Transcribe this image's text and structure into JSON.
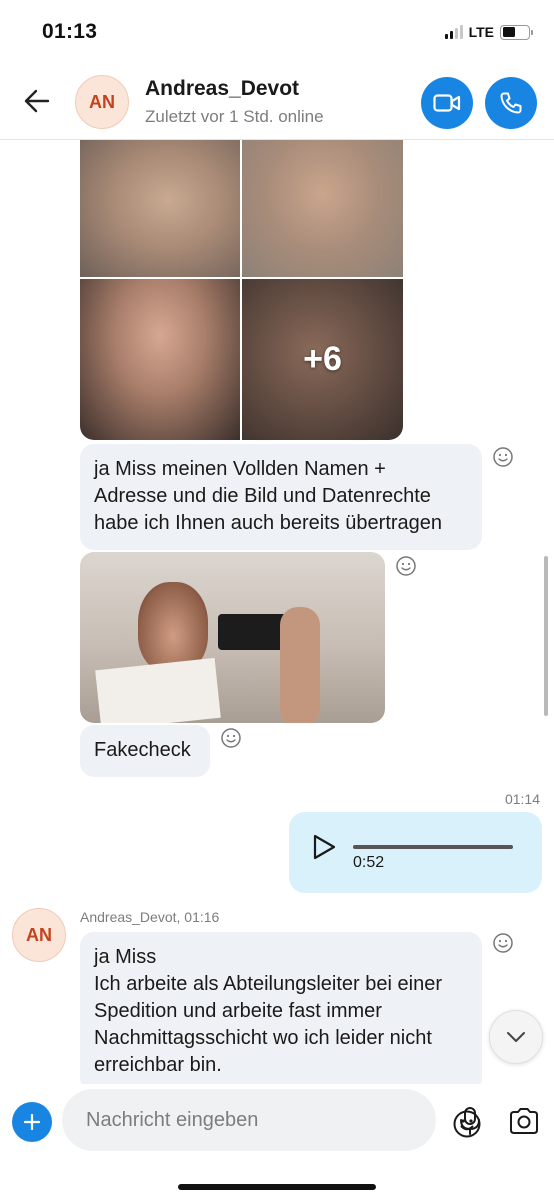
{
  "status_bar": {
    "time": "01:13",
    "network": "LTE"
  },
  "header": {
    "avatar_initials": "AN",
    "contact_name": "Andreas_Devot",
    "contact_status": "Zuletzt vor 1 Std. online"
  },
  "messages": {
    "photo_grid": {
      "more_count_label": "+6"
    },
    "text1": "ja Miss meinen Vollden Namen +\nAdresse und die Bild und Datenrechte\nhabe ich Ihnen auch bereits übertragen",
    "text2": "Fakecheck",
    "outgoing_time": "01:14",
    "voice_duration": "0:52",
    "sender_line": "Andreas_Devot, 01:16",
    "sender_initials": "AN",
    "text3": "ja Miss\nIch arbeite als Abteilungsleiter bei einer\nSpedition und arbeite fast immer\nNachmittagsschicht wo ich leider nicht\nerreichbar bin."
  },
  "composer": {
    "placeholder": "Nachricht eingeben"
  },
  "colors": {
    "accent": "#1985e3",
    "bubble_in": "#eef1f5",
    "bubble_out": "#d9f1fb",
    "avatar_bg": "#fbe4d8",
    "avatar_text": "#c2431d"
  }
}
